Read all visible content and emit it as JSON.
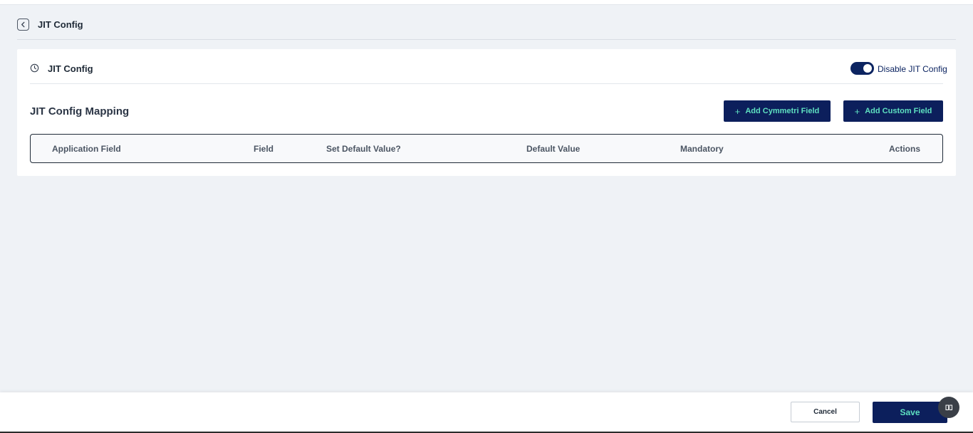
{
  "header": {
    "title": "JIT Config"
  },
  "card": {
    "title": "JIT Config",
    "toggle": {
      "label": "Disable JIT Config",
      "checked": true
    },
    "section_title": "JIT Config Mapping",
    "buttons": {
      "add_cymmetri_field": "Add Cymmetri Field",
      "add_custom_field": "Add Custom Field",
      "plus_glyph": "+"
    },
    "table": {
      "columns": [
        "Application Field",
        "Field",
        "Set Default Value?",
        "Default Value",
        "Mandatory",
        "Actions"
      ],
      "rows": []
    }
  },
  "footer": {
    "cancel_label": "Cancel",
    "save_label": "Save"
  },
  "colors": {
    "primary_navy": "#0c1f5c",
    "accent_teal": "#5ee0c0",
    "background": "#eff2f6"
  },
  "icons": {
    "back": "chevron-left-icon",
    "clock": "clock-icon",
    "help": "book-icon"
  }
}
